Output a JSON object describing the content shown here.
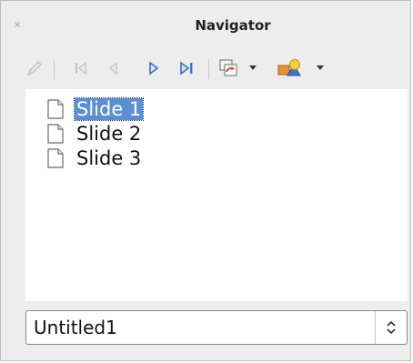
{
  "window": {
    "title": "Navigator",
    "close_glyph": "×"
  },
  "toolbar": {
    "buttons": [
      {
        "name": "pen-icon",
        "enabled": false
      },
      {
        "name": "first-slide-icon",
        "enabled": false
      },
      {
        "name": "previous-slide-icon",
        "enabled": false
      },
      {
        "name": "next-slide-icon",
        "enabled": true
      },
      {
        "name": "last-slide-icon",
        "enabled": true
      },
      {
        "name": "drag-mode-icon",
        "enabled": true
      },
      {
        "name": "shapes-icon",
        "enabled": true
      }
    ],
    "accent": "#3a6fc4"
  },
  "tree": {
    "items": [
      {
        "label": "Slide 1",
        "selected": true
      },
      {
        "label": "Slide 2",
        "selected": false
      },
      {
        "label": "Slide 3",
        "selected": false
      }
    ],
    "selection_color": "#5b8fd3"
  },
  "document_select": {
    "value": "Untitled1"
  }
}
